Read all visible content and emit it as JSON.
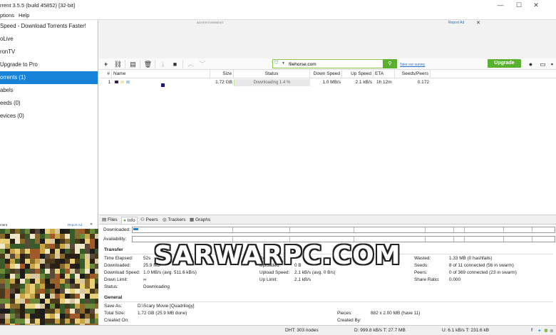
{
  "window": {
    "title": "rrent 3.5.5  (build 45852) [32-bit]",
    "minimize_icon": "minimize-icon",
    "maximize_icon": "maximize-icon",
    "close_icon": "close-icon"
  },
  "menu": {
    "items": [
      "ptions",
      "Help"
    ]
  },
  "sidebar": {
    "items": [
      {
        "label": "Speed - Download Torrents Faster!",
        "selected": false
      },
      {
        "label": "oLive",
        "selected": false
      },
      {
        "label": "ronTV",
        "selected": false
      },
      {
        "label": "Upgrade to Pro",
        "selected": false
      },
      {
        "label": "orrents (1)",
        "selected": true
      },
      {
        "label": "abels",
        "selected": false
      },
      {
        "label": "eeds (0)",
        "selected": false
      },
      {
        "label": "evices (0)",
        "selected": false
      }
    ]
  },
  "ad_banner": {
    "label": "ADVERTISEMENT",
    "report": "Report Ad",
    "close": "✕"
  },
  "toolbar": {
    "buttons": [
      "add-torrent-icon",
      "add-link-icon",
      "create-torrent-icon",
      "delete-icon",
      "start-icon",
      "stop-icon",
      "move-up-icon",
      "move-down-icon"
    ],
    "search_value": "filehorse.com",
    "survey_link": "Take our survey",
    "upgrade_label": "Upgrade",
    "right_icons": [
      "bulb-icon",
      "chat-icon",
      "remote-icon",
      "settings-icon"
    ]
  },
  "grid": {
    "headers": [
      "#",
      "Name",
      "Size",
      "Status",
      "Down Speed",
      "Up Speed",
      "ETA",
      "Seeds/Peers"
    ],
    "rows": [
      {
        "num": "1",
        "size": "1.72 GB",
        "status": "Downloading 1.4 %",
        "progress": 1.4,
        "down": "1.0 MB/s",
        "up": "2.1 kB/s",
        "eta": "1h 12m",
        "seeds": "0.172"
      }
    ]
  },
  "detail_tabs": [
    "Files",
    "Info",
    "Peers",
    "Trackers",
    "Graphs"
  ],
  "bars": {
    "downloaded": "Downloaded:",
    "availability": "Availability:"
  },
  "transfer": {
    "heading": "Transfer",
    "col1": [
      [
        "Time Elapsed:",
        "52s"
      ],
      [
        "Downloaded:",
        "25.9 MB"
      ],
      [
        "Download Speed:",
        "1.0 MB/s (avg. 511.6 kB/s)"
      ],
      [
        "Down Limit:",
        "∞"
      ],
      [
        "Status:",
        "Downloading"
      ]
    ],
    "col2": [
      [
        "Remaining:",
        ""
      ],
      [
        "Uploaded:",
        "0 B"
      ],
      [
        "Upload Speed:",
        "2.1 kB/s (avg. 0 B/s)"
      ],
      [
        "Up Limit:",
        "2.1 kB/s"
      ]
    ],
    "col3": [
      [
        "Wasted:",
        "1.33 MB (0 hashfails)"
      ],
      [
        "Seeds:",
        "8 of 11 connected (56 in swarm)"
      ],
      [
        "Peers:",
        "0 of 369 connected (23 in swarm)"
      ],
      [
        "Share Ratio:",
        "0.000"
      ]
    ]
  },
  "general": {
    "heading": "General",
    "col1": [
      [
        "Save As:",
        "D:\\Scary Movie [Quadrilogy]"
      ],
      [
        "Total Size:",
        "1.72 GB (25.9 MB done)"
      ],
      [
        "Created On:",
        ""
      ]
    ],
    "col2": [
      [
        "Pieces:",
        "882 x 2.00 MB (have 11)"
      ],
      [
        "Created By:",
        ""
      ]
    ]
  },
  "side_ad": {
    "label": "ment",
    "report": "Report Ad",
    "close": "✕"
  },
  "status_bar": {
    "dht": "DHT: 303 nodes",
    "down": "D: 999.8 kB/s T: 27.7 MB",
    "up": "U: 6.1 kB/s T: 231.6 kB",
    "social_icons": [
      "facebook-icon",
      "twitter-icon",
      "android-icon",
      "network-icon",
      "warning-icon"
    ]
  },
  "watermark": "SARWARPC.COM",
  "colors": {
    "accent": "#1683d8",
    "green": "#5cb030",
    "link": "#2a6fc9"
  }
}
